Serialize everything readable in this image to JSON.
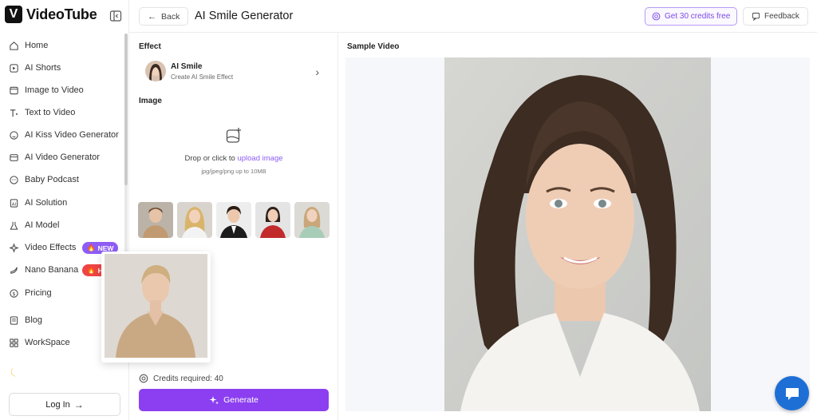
{
  "brand": {
    "logo_letter": "V",
    "name": "VideoTube"
  },
  "sidebar": {
    "items": [
      {
        "label": "Home",
        "icon": "home-icon"
      },
      {
        "label": "AI Shorts",
        "icon": "shorts-icon"
      },
      {
        "label": "Image to Video",
        "icon": "image-video-icon"
      },
      {
        "label": "Text to Video",
        "icon": "text-video-icon"
      },
      {
        "label": "AI Kiss Video Generator",
        "icon": "kiss-icon"
      },
      {
        "label": "AI Video Generator",
        "icon": "video-gen-icon"
      },
      {
        "label": "Baby Podcast",
        "icon": "baby-icon"
      },
      {
        "label": "AI Solution",
        "icon": "solution-icon"
      },
      {
        "label": "AI Model",
        "icon": "flask-icon"
      },
      {
        "label": "Video Effects",
        "icon": "effects-icon",
        "badge": "NEW"
      },
      {
        "label": "Nano Banana",
        "icon": "banana-icon",
        "badge": "HOT"
      },
      {
        "label": "Pricing",
        "icon": "pricing-icon"
      },
      {
        "label": "Blog",
        "icon": "blog-icon"
      },
      {
        "label": "WorkSpace",
        "icon": "workspace-icon"
      }
    ],
    "login_label": "Log In"
  },
  "header": {
    "back_label": "Back",
    "title": "AI Smile Generator",
    "credits_label": "Get 30 credits free",
    "feedback_label": "Feedback"
  },
  "panel": {
    "effect_section": "Effect",
    "effect_name": "AI Smile",
    "effect_desc": "Create AI Smile Effect",
    "image_section": "Image",
    "drop_text": "Drop or click to ",
    "drop_link": "upload image",
    "drop_hint": "jpg/jpeg/png up to 10MB",
    "credits_text": "Credits required: 40",
    "generate_label": "Generate"
  },
  "preview": {
    "label": "Sample Video"
  },
  "colors": {
    "accent": "#8b3ff0",
    "new_badge": "#8e5cf5",
    "hot_badge": "#ef4444",
    "chat": "#1d6fd6"
  }
}
